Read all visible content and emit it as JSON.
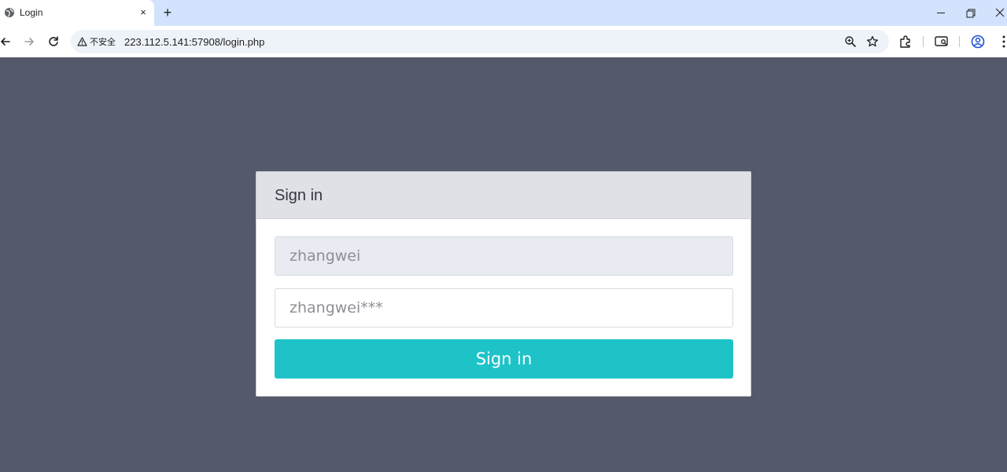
{
  "browser": {
    "tab_title": "Login",
    "tab_close": "×",
    "new_tab": "+",
    "security_label": "不安全",
    "url": "223.112.5.141:57908/login.php"
  },
  "login": {
    "heading": "Sign in",
    "username_value": "zhangwei",
    "password_value": "zhangwei***",
    "submit_label": "Sign in"
  },
  "colors": {
    "page_background": "#545a6b",
    "card_header": "#dfe1e6",
    "username_field": "#e8ebf1",
    "submit_button": "#1ec3c8",
    "tabstrip": "#d3e3fd"
  },
  "icons": [
    "globe-icon",
    "close-icon",
    "plus-icon",
    "minimize-icon",
    "restore-icon",
    "window-close-icon",
    "back-arrow-icon",
    "forward-arrow-icon",
    "reload-icon",
    "warning-icon",
    "zoom-icon",
    "star-icon",
    "extensions-icon",
    "cast-icon",
    "profile-icon",
    "menu-icon"
  ]
}
